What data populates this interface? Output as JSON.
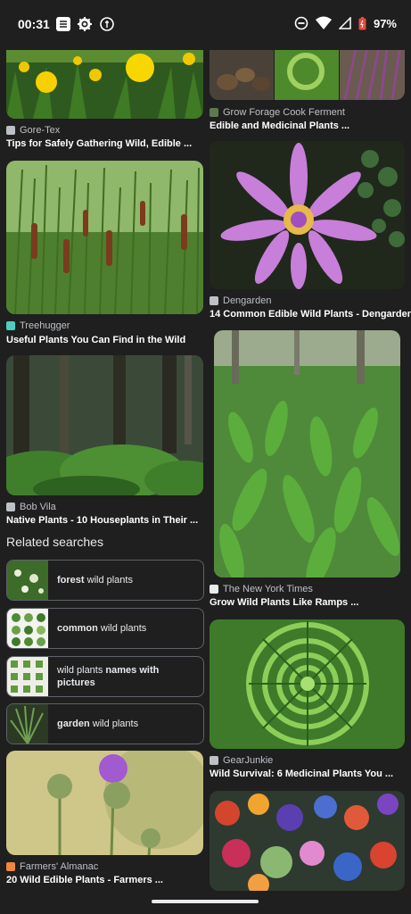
{
  "status": {
    "time": "00:31",
    "battery": "97%"
  },
  "left_cards": [
    {
      "source": "Gore-Tex",
      "title": "Tips for Safely Gathering Wild, Edible ..."
    },
    {
      "source": "Treehugger",
      "title": "Useful Plants You Can Find in the Wild"
    },
    {
      "source": "Bob Vila",
      "title": "Native Plants - 10 Houseplants in Their ..."
    },
    {
      "source": "Farmers' Almanac",
      "title": "20 Wild Edible Plants - Farmers ..."
    }
  ],
  "right_cards": [
    {
      "source": "Grow Forage Cook Ferment",
      "title": "Edible and Medicinal Plants ..."
    },
    {
      "source": "Dengarden",
      "title": "14 Common Edible Wild Plants - Dengarden"
    },
    {
      "source": "The New York Times",
      "title": "Grow Wild Plants Like Ramps ..."
    },
    {
      "source": "GearJunkie",
      "title": "Wild Survival: 6 Medicinal Plants You ..."
    }
  ],
  "related": {
    "heading": "Related searches",
    "items": [
      {
        "bold": "forest",
        "rest": " wild plants"
      },
      {
        "bold": "common",
        "rest": " wild plants"
      },
      {
        "pre": "wild plants ",
        "bold": "names with",
        "post": "pictures"
      },
      {
        "bold": "garden",
        "rest": " wild plants"
      }
    ]
  }
}
